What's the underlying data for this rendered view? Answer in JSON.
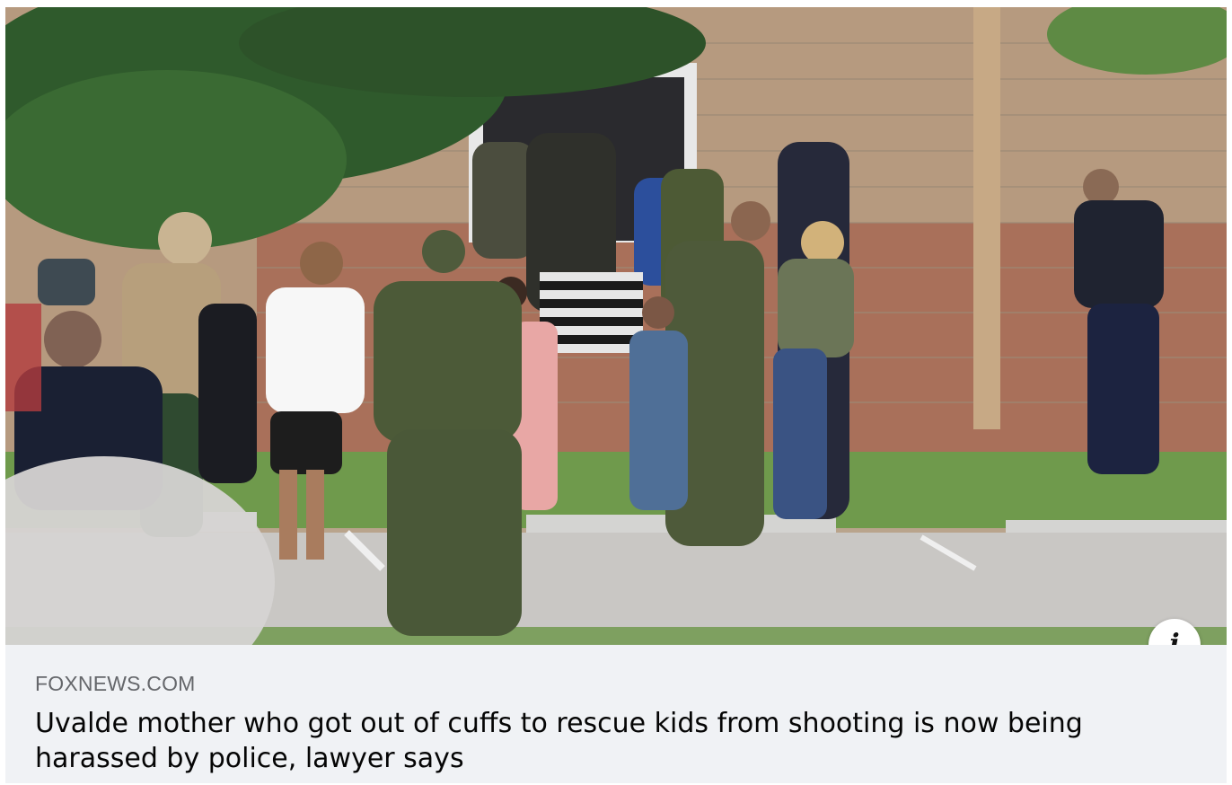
{
  "card": {
    "image_description_alt": "",
    "info_icon": "info-icon",
    "info_glyph": "i",
    "source_domain": "FOXNEWS.COM",
    "headline": "Uvalde mother who got out of cuffs to rescue kids from shooting is now being harassed by police, lawyer says"
  },
  "colors": {
    "caption_background": "#f0f2f5",
    "domain_text": "#65676b",
    "headline_text": "#050505"
  }
}
